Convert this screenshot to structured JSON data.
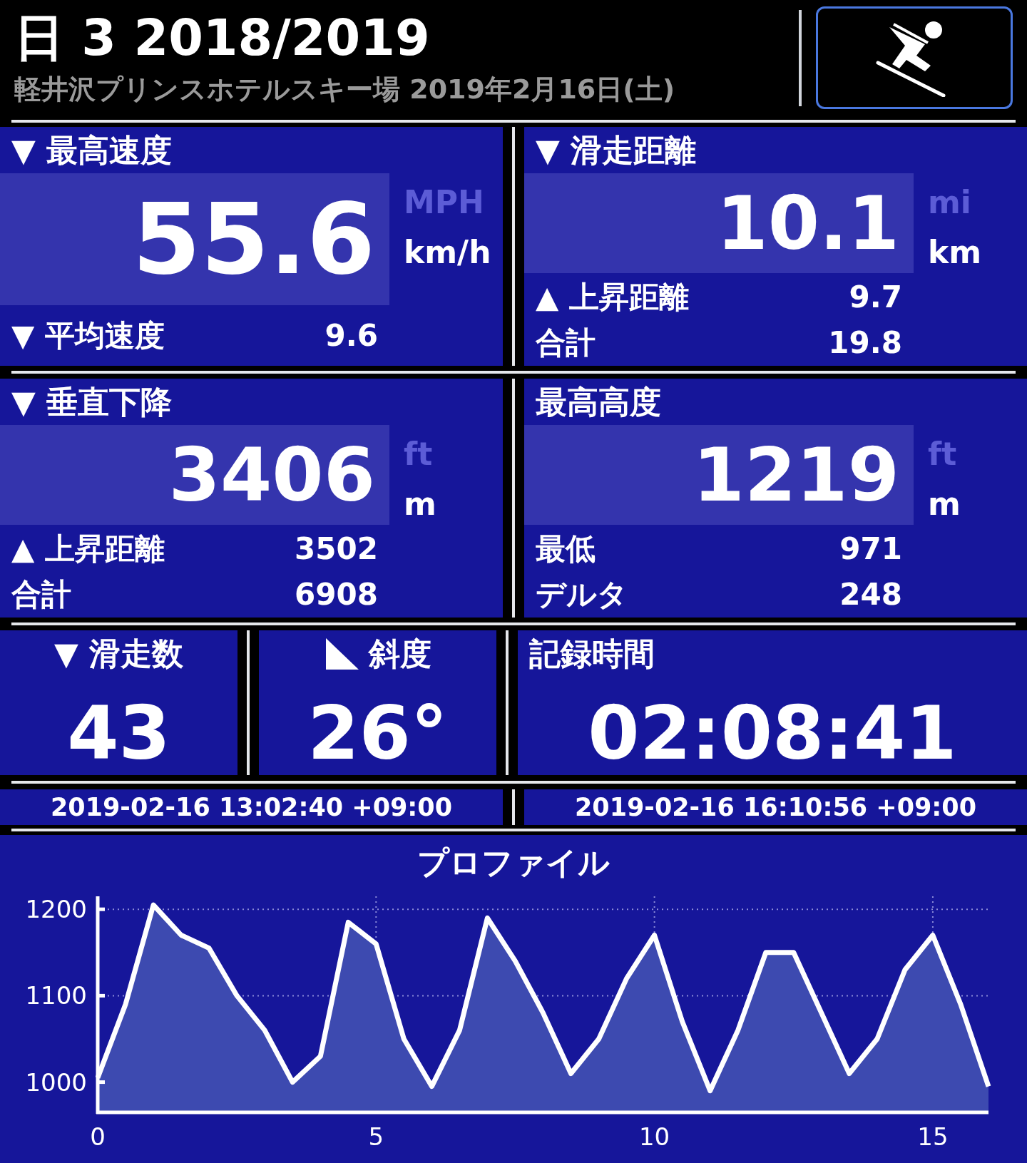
{
  "header": {
    "title": "日 3 2018/2019",
    "subtitle": "軽井沢プリンスホテルスキー場 2019年2月16日(土)"
  },
  "stats": [
    {
      "heading": "▼ 最高速度",
      "value": "55.6",
      "units": [
        {
          "text": "MPH",
          "selected": false
        },
        {
          "text": "km/h",
          "selected": true
        }
      ],
      "rows": [
        {
          "label": "▼ 平均速度",
          "value": "9.6"
        }
      ]
    },
    {
      "heading": "▼ 滑走距離",
      "value": "10.1",
      "units": [
        {
          "text": "mi",
          "selected": false
        },
        {
          "text": "km",
          "selected": true
        }
      ],
      "rows": [
        {
          "label": "▲ 上昇距離",
          "value": "9.7"
        },
        {
          "label": "合計",
          "value": "19.8"
        }
      ]
    },
    {
      "heading": "▼ 垂直下降",
      "value": "3406",
      "units": [
        {
          "text": "ft",
          "selected": false
        },
        {
          "text": "m",
          "selected": true
        }
      ],
      "rows": [
        {
          "label": "▲ 上昇距離",
          "value": "3502"
        },
        {
          "label": "合計",
          "value": "6908"
        }
      ]
    },
    {
      "heading": "最高高度",
      "value": "1219",
      "units": [
        {
          "text": "ft",
          "selected": false
        },
        {
          "text": "m",
          "selected": true
        }
      ],
      "rows": [
        {
          "label": "最低",
          "value": "971"
        },
        {
          "label": "デルタ",
          "value": "248"
        }
      ]
    }
  ],
  "tiles": [
    {
      "kind": "runs",
      "label": "▼ 滑走数",
      "value": "43"
    },
    {
      "kind": "slope",
      "label": "斜度",
      "value": "26°"
    },
    {
      "kind": "time",
      "label": "記録時間",
      "value": "02:08:41"
    }
  ],
  "timestamps": [
    "2019-02-16 13:02:40 +09:00",
    "2019-02-16 16:10:56 +09:00"
  ],
  "profile": {
    "title": "プロファイル",
    "chart_data": {
      "type": "area",
      "x": [
        0,
        0.5,
        1,
        1.5,
        2,
        2.5,
        3,
        3.5,
        4,
        4.5,
        5,
        5.5,
        6,
        6.5,
        7,
        7.5,
        8,
        8.5,
        9,
        9.5,
        10,
        10.5,
        11,
        11.5,
        12,
        12.5,
        13,
        13.5,
        14,
        14.5,
        15,
        15.5,
        16
      ],
      "series": [
        {
          "color": "#ffffff",
          "values": [
            1005,
            1090,
            1205,
            1170,
            1155,
            1100,
            1060,
            1000,
            1030,
            1185,
            1160,
            1050,
            995,
            1060,
            1190,
            1140,
            1080,
            1010,
            1050,
            1120,
            1170,
            1070,
            990,
            1060,
            1150,
            1150,
            1080,
            1010,
            1050,
            1130,
            1170,
            1090,
            995
          ]
        }
      ],
      "grid": true,
      "xlim": [
        0,
        16
      ],
      "ylim": [
        965,
        1215
      ],
      "xticks": [
        0,
        5,
        10,
        15
      ],
      "yticks": [
        1000,
        1100,
        1200
      ]
    }
  }
}
